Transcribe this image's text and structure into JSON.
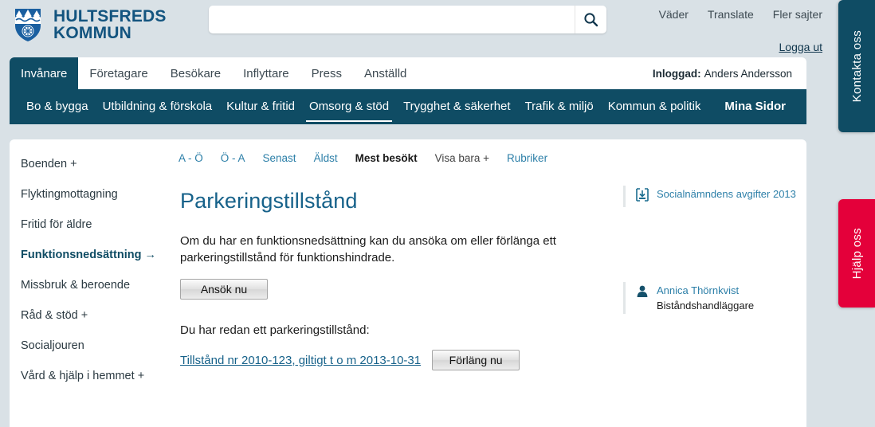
{
  "brand": {
    "line1": "HULTSFREDS",
    "line2": "KOMMUN",
    "logo_icon": "coat-of-arms-icon",
    "color": "#13547f"
  },
  "search": {
    "value": "",
    "placeholder": "",
    "button_icon": "search-icon"
  },
  "top_links": [
    {
      "label": "Väder"
    },
    {
      "label": "Translate"
    },
    {
      "label": "Fler sajter"
    }
  ],
  "logout": {
    "label": "Logga ut"
  },
  "tabs": [
    {
      "label": "Invånare",
      "active": true
    },
    {
      "label": "Företagare",
      "active": false
    },
    {
      "label": "Besökare",
      "active": false
    },
    {
      "label": "Inflyttare",
      "active": false
    },
    {
      "label": "Press",
      "active": false
    },
    {
      "label": "Anställd",
      "active": false
    }
  ],
  "logged_in": {
    "prefix": "Inloggad:",
    "user": "Anders Andersson"
  },
  "subnav": [
    {
      "label": "Bo & bygga",
      "active": false
    },
    {
      "label": "Utbildning & förskola",
      "active": false
    },
    {
      "label": "Kultur & fritid",
      "active": false
    },
    {
      "label": "Omsorg & stöd",
      "active": true
    },
    {
      "label": "Trygghet & säkerhet",
      "active": false
    },
    {
      "label": "Trafik & miljö",
      "active": false
    },
    {
      "label": "Kommun & politik",
      "active": false
    },
    {
      "label": "Mina Sidor",
      "active": false,
      "bold": true
    }
  ],
  "sidebar": [
    {
      "label": "Boenden",
      "suffix": "+"
    },
    {
      "label": "Flyktingmottagning",
      "suffix": ""
    },
    {
      "label": "Fritid för äldre",
      "suffix": ""
    },
    {
      "label": "Funktionsnedsättning",
      "suffix": "→",
      "active": true
    },
    {
      "label": "Missbruk & beroende",
      "suffix": ""
    },
    {
      "label": "Råd & stöd",
      "suffix": "+"
    },
    {
      "label": "Socialjouren",
      "suffix": ""
    },
    {
      "label": "Vård & hjälp i hemmet",
      "suffix": "+"
    }
  ],
  "sort_row": [
    {
      "label": "A - Ö",
      "style": "link"
    },
    {
      "label": "Ö - A",
      "style": "link"
    },
    {
      "label": "Senast",
      "style": "link"
    },
    {
      "label": "Äldst",
      "style": "link"
    },
    {
      "label": "Mest besökt",
      "style": "active"
    },
    {
      "label": "Visa bara +",
      "style": "muted"
    },
    {
      "label": "Rubriker",
      "style": "link"
    }
  ],
  "article": {
    "title": "Parkeringstillstånd",
    "intro": "Om du har en funktionsnedsättning kan du ansöka om eller förlänga ett parkeringstillstånd för funktionshindrade.",
    "apply_button": "Ansök nu",
    "existing_label": "Du har redan ett parkeringstillstånd:",
    "permit_link": "Tillstånd nr 2010-123, giltigt t o m 2013-10-31",
    "extend_button": "Förläng nu"
  },
  "related": [
    {
      "icon": "pdf-document-icon",
      "title": "Socialnämndens avgifter 2013",
      "subtitle": ""
    },
    {
      "icon": "person-icon",
      "title": "Annica Thörnkvist",
      "subtitle": "Biståndshandläggare"
    }
  ],
  "side_flags": [
    {
      "label": "Kontakta oss",
      "color": "#0f4c64"
    },
    {
      "label": "Hjälp oss",
      "color": "#e4003a"
    }
  ]
}
